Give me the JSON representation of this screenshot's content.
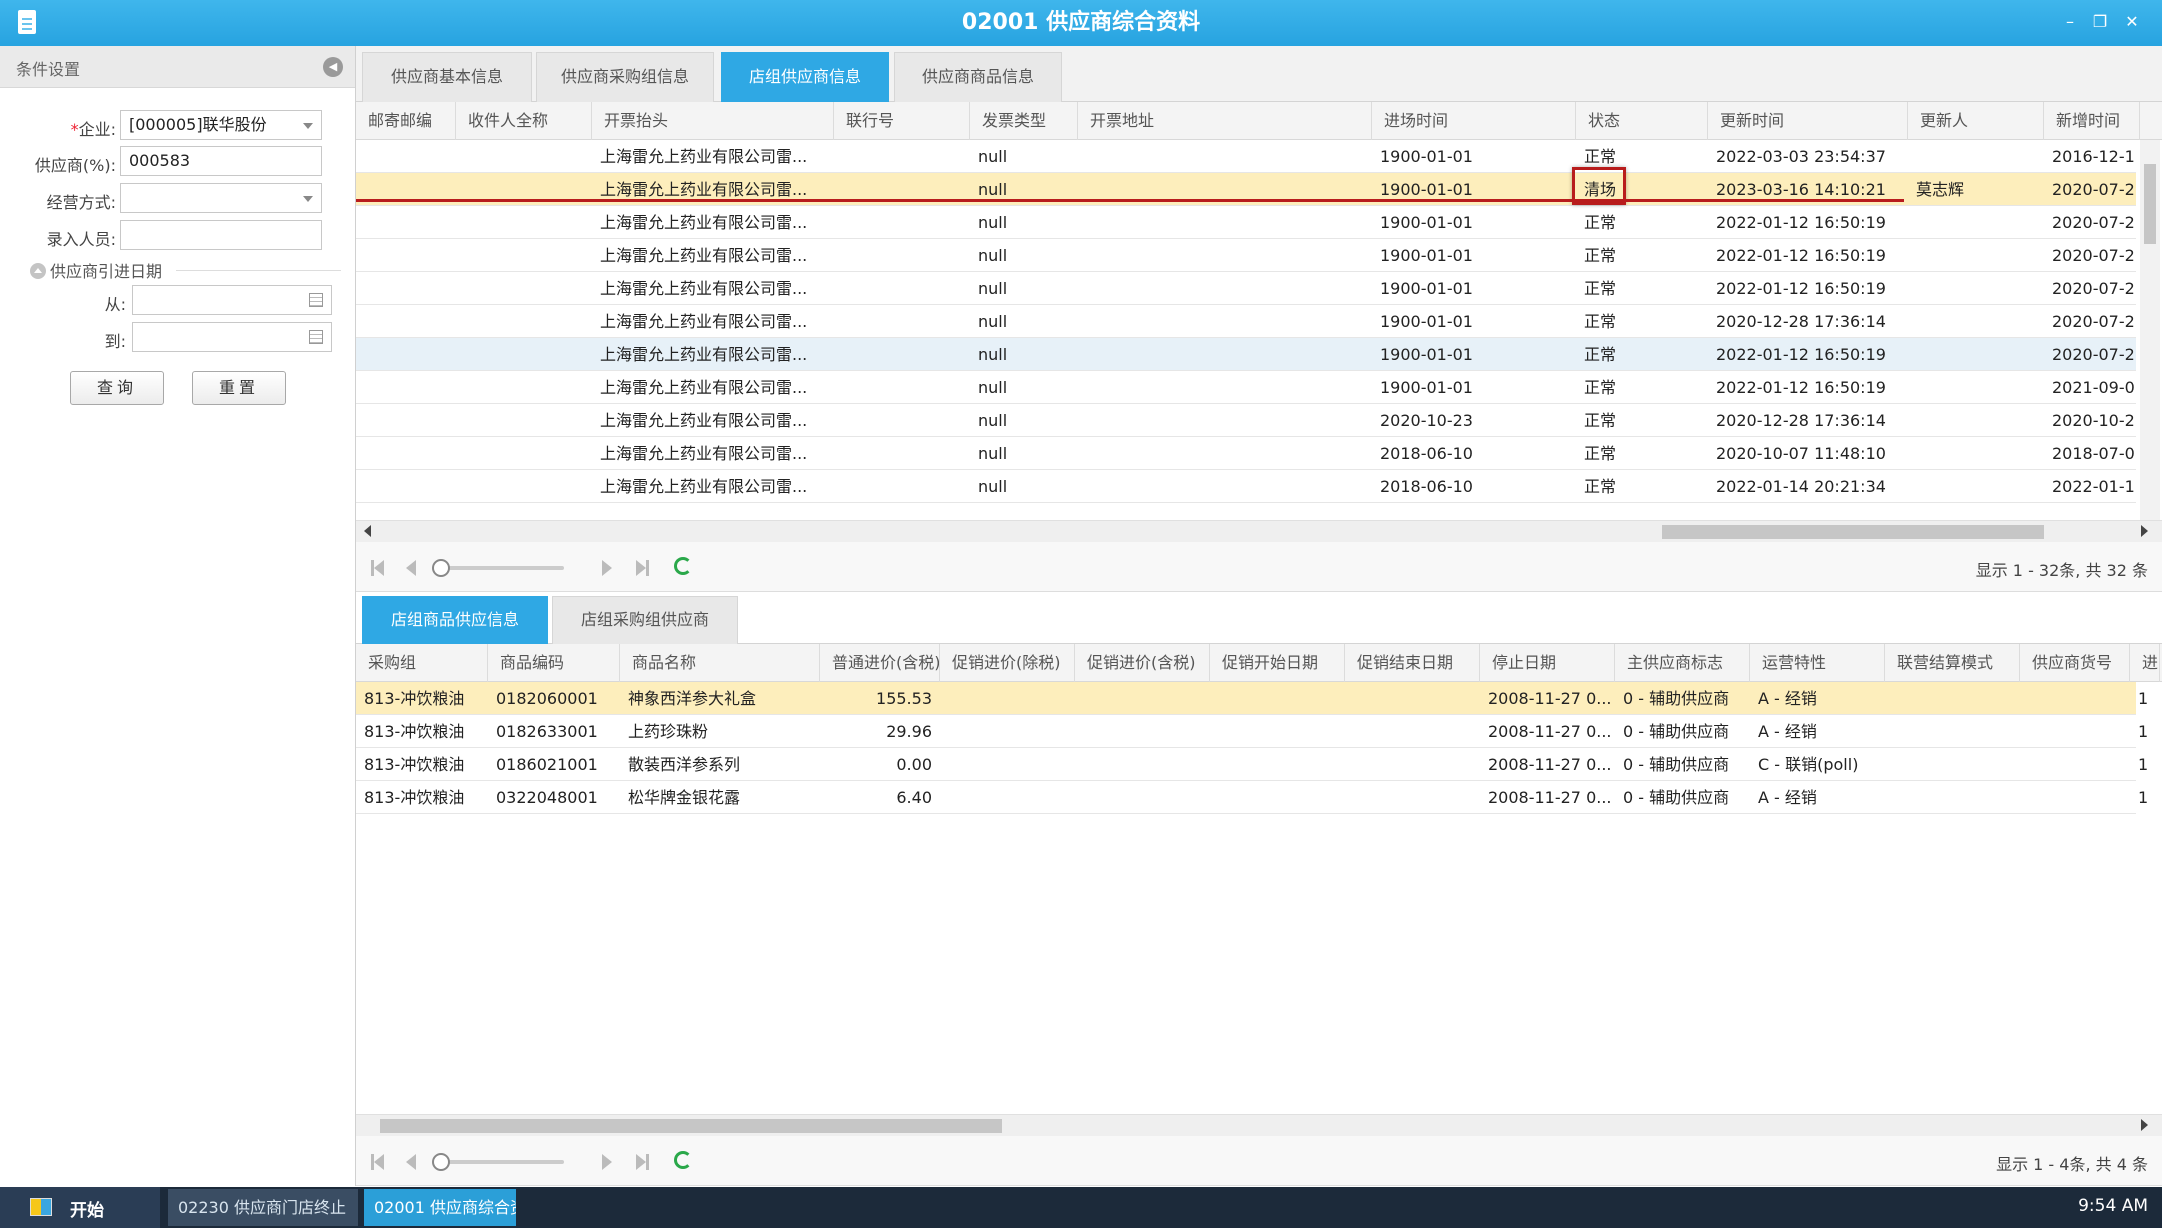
{
  "window": {
    "title": "02001 供应商综合资料",
    "controls": {
      "minimize": "–",
      "restore": "❐",
      "close": "✕"
    }
  },
  "filter_panel": {
    "header": "条件设置",
    "fields": {
      "company": {
        "label": "企业:",
        "required_mark": "*",
        "value": "[000005]联华股份"
      },
      "supplier": {
        "label": "供应商(%):",
        "value": "000583"
      },
      "operation_mode": {
        "label": "经营方式:",
        "value": ""
      },
      "entry_person": {
        "label": "录入人员:",
        "value": ""
      }
    },
    "date_group": {
      "title": "供应商引进日期",
      "from_label": "从:",
      "to_label": "到:",
      "from_value": "",
      "to_value": ""
    },
    "query_button": "查询",
    "reset_button": "重置"
  },
  "tabs": [
    {
      "label": "供应商基本信息",
      "active": false
    },
    {
      "label": "供应商采购组信息",
      "active": false
    },
    {
      "label": "店组供应商信息",
      "active": true
    },
    {
      "label": "供应商商品信息",
      "active": false
    }
  ],
  "upper_grid": {
    "columns": [
      "邮寄邮编",
      "收件人全称",
      "开票抬头",
      "联行号",
      "发票类型",
      "开票地址",
      "进场时间",
      "状态",
      "更新时间",
      "更新人",
      "新增时间"
    ],
    "rows": [
      [
        "",
        "",
        "上海雷允上药业有限公司雷...",
        "",
        "null",
        "",
        "1900-01-01",
        "正常",
        "2022-03-03 23:54:37",
        "",
        "2016-12-1"
      ],
      [
        "",
        "",
        "上海雷允上药业有限公司雷...",
        "",
        "null",
        "",
        "1900-01-01",
        "清场",
        "2023-03-16 14:10:21",
        "莫志辉",
        "2020-07-2"
      ],
      [
        "",
        "",
        "上海雷允上药业有限公司雷...",
        "",
        "null",
        "",
        "1900-01-01",
        "正常",
        "2022-01-12 16:50:19",
        "",
        "2020-07-2"
      ],
      [
        "",
        "",
        "上海雷允上药业有限公司雷...",
        "",
        "null",
        "",
        "1900-01-01",
        "正常",
        "2022-01-12 16:50:19",
        "",
        "2020-07-2"
      ],
      [
        "",
        "",
        "上海雷允上药业有限公司雷...",
        "",
        "null",
        "",
        "1900-01-01",
        "正常",
        "2022-01-12 16:50:19",
        "",
        "2020-07-2"
      ],
      [
        "",
        "",
        "上海雷允上药业有限公司雷...",
        "",
        "null",
        "",
        "1900-01-01",
        "正常",
        "2020-12-28 17:36:14",
        "",
        "2020-07-2"
      ],
      [
        "",
        "",
        "上海雷允上药业有限公司雷...",
        "",
        "null",
        "",
        "1900-01-01",
        "正常",
        "2022-01-12 16:50:19",
        "",
        "2020-07-2"
      ],
      [
        "",
        "",
        "上海雷允上药业有限公司雷...",
        "",
        "null",
        "",
        "1900-01-01",
        "正常",
        "2022-01-12 16:50:19",
        "",
        "2021-09-0"
      ],
      [
        "",
        "",
        "上海雷允上药业有限公司雷...",
        "",
        "null",
        "",
        "2020-10-23",
        "正常",
        "2020-12-28 17:36:14",
        "",
        "2020-10-2"
      ],
      [
        "",
        "",
        "上海雷允上药业有限公司雷...",
        "",
        "null",
        "",
        "2018-06-10",
        "正常",
        "2020-10-07 11:48:10",
        "",
        "2018-07-0"
      ],
      [
        "",
        "",
        "上海雷允上药业有限公司雷...",
        "",
        "null",
        "",
        "2018-06-10",
        "正常",
        "2022-01-14 20:21:34",
        "",
        "2022-01-1"
      ]
    ],
    "pager_info": "显示 1 - 32条, 共 32 条"
  },
  "bottom_tabs": [
    {
      "label": "店组商品供应信息",
      "active": true
    },
    {
      "label": "店组采购组供应商",
      "active": false
    }
  ],
  "lower_grid": {
    "columns": [
      "采购组",
      "商品编码",
      "商品名称",
      "普通进价(含税)",
      "促销进价(除税)",
      "促销进价(含税)",
      "促销开始日期",
      "促销结束日期",
      "停止日期",
      "主供应商标志",
      "运营特性",
      "联营结算模式",
      "供应商货号",
      "进"
    ],
    "rows": [
      [
        "813-冲饮粮油",
        "0182060001",
        "神象西洋参大礼盒",
        "155.53",
        "",
        "",
        "",
        "",
        "2008-11-27 0...",
        "0 - 辅助供应商",
        "A - 经销",
        "",
        "",
        "1"
      ],
      [
        "813-冲饮粮油",
        "0182633001",
        "上药珍珠粉",
        "29.96",
        "",
        "",
        "",
        "",
        "2008-11-27 0...",
        "0 - 辅助供应商",
        "A - 经销",
        "",
        "",
        "1"
      ],
      [
        "813-冲饮粮油",
        "0186021001",
        "散装西洋参系列",
        "0.00",
        "",
        "",
        "",
        "",
        "2008-11-27 0...",
        "0 - 辅助供应商",
        "C - 联销(poll)",
        "",
        "",
        "1"
      ],
      [
        "813-冲饮粮油",
        "0322048001",
        "松华牌金银花露",
        "6.40",
        "",
        "",
        "",
        "",
        "2008-11-27 0...",
        "0 - 辅助供应商",
        "A - 经销",
        "",
        "",
        "1"
      ]
    ],
    "pager_info": "显示 1 - 4条, 共 4 条"
  },
  "taskbar": {
    "start_label": "开始",
    "tasks": [
      {
        "label": "02230 供应商门店终止",
        "active": false
      },
      {
        "label": "02001 供应商综合资料",
        "active": true
      }
    ],
    "clock": "9:54 AM"
  }
}
